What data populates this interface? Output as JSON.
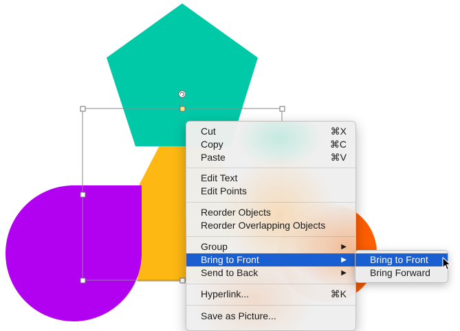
{
  "colors": {
    "pentagon": "#00c9a7",
    "hexagon": "#fdb813",
    "teardrop": "#b200f0",
    "circle": "#ff5e00",
    "highlight": "#1a5fd2"
  },
  "context_menu": {
    "items": [
      {
        "label": "Cut",
        "shortcut": "⌘X"
      },
      {
        "label": "Copy",
        "shortcut": "⌘C"
      },
      {
        "label": "Paste",
        "shortcut": "⌘V"
      },
      {
        "label": "Edit Text"
      },
      {
        "label": "Edit Points"
      },
      {
        "label": "Reorder Objects"
      },
      {
        "label": "Reorder Overlapping Objects"
      },
      {
        "label": "Group",
        "submenu": "▶"
      },
      {
        "label": "Bring to Front",
        "submenu": "▶"
      },
      {
        "label": "Send to Back",
        "submenu": "▶"
      },
      {
        "label": "Hyperlink...",
        "shortcut": "⌘K"
      },
      {
        "label": "Save as Picture..."
      }
    ]
  },
  "submenu": {
    "items": [
      {
        "label": "Bring to Front"
      },
      {
        "label": "Bring Forward"
      }
    ]
  }
}
